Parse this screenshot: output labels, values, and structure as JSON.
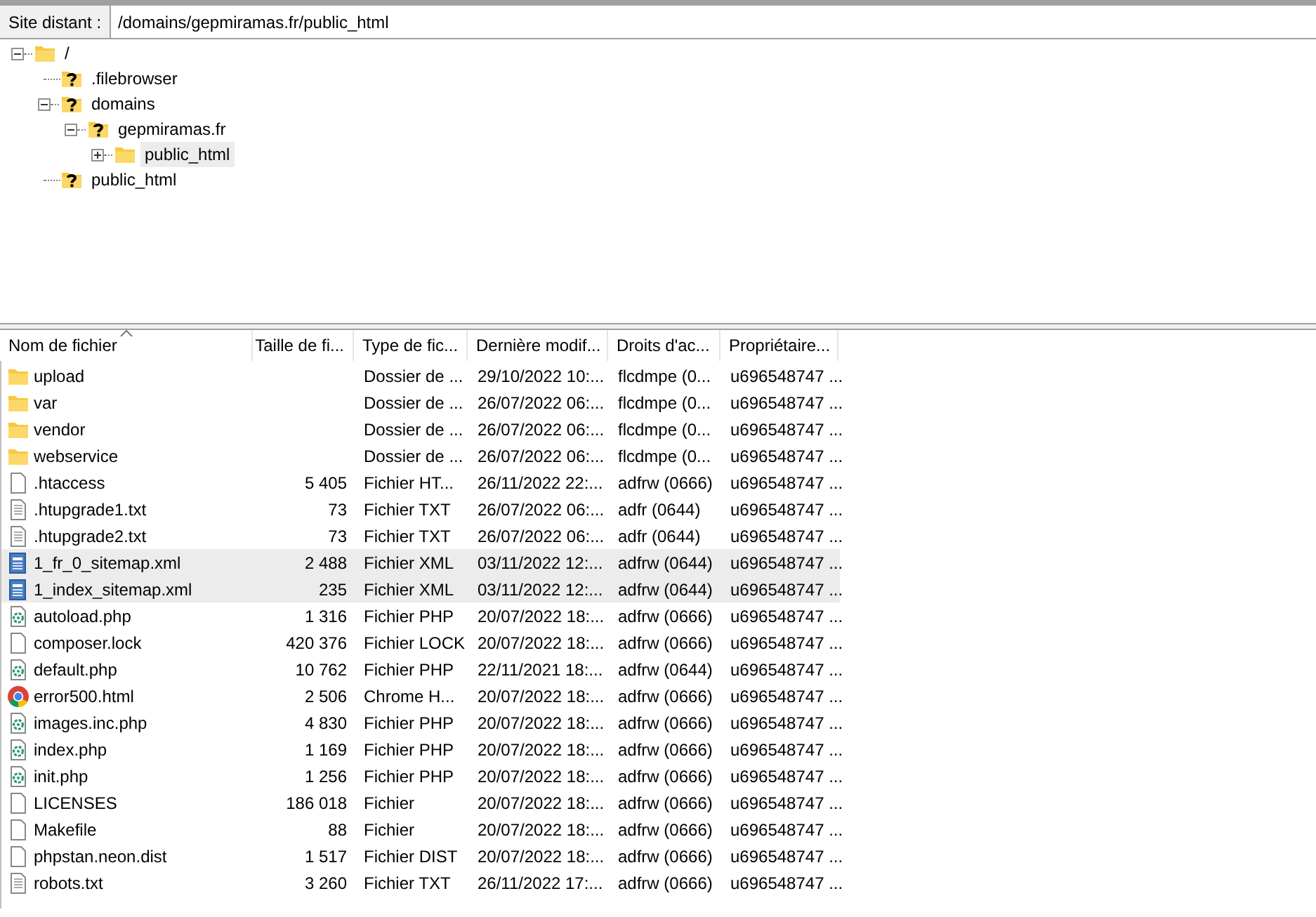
{
  "path_bar": {
    "label": "Site distant :",
    "value": "/domains/gepmiramas.fr/public_html"
  },
  "tree": [
    {
      "label": "/",
      "kind": "folder",
      "expandable": true,
      "expanded": true,
      "selected": false,
      "children": [
        {
          "label": ".filebrowser",
          "kind": "unknown",
          "expandable": false,
          "selected": false
        },
        {
          "label": "domains",
          "kind": "unknown",
          "expandable": true,
          "expanded": true,
          "selected": false,
          "children": [
            {
              "label": "gepmiramas.fr",
              "kind": "unknown",
              "expandable": true,
              "expanded": true,
              "selected": false,
              "children": [
                {
                  "label": "public_html",
                  "kind": "folder",
                  "expandable": true,
                  "expanded": false,
                  "selected": true
                }
              ]
            }
          ]
        },
        {
          "label": "public_html",
          "kind": "unknown",
          "expandable": false,
          "selected": false
        }
      ]
    }
  ],
  "file_list": {
    "columns": [
      {
        "label": "Nom de fichier",
        "sorted": true
      },
      {
        "label": "Taille de fi...",
        "sorted": false
      },
      {
        "label": "Type de fic...",
        "sorted": false
      },
      {
        "label": "Dernière modif...",
        "sorted": false
      },
      {
        "label": "Droits d'ac...",
        "sorted": false
      },
      {
        "label": "Propriétaire...",
        "sorted": false
      }
    ],
    "rows": [
      {
        "kind": "folder",
        "name": "upload",
        "type": "Dossier de ...",
        "modified": "29/10/2022 10:...",
        "rights": "flcdmpe (0...",
        "owner": "u696548747 ...",
        "selected": false
      },
      {
        "kind": "folder",
        "name": "var",
        "type": "Dossier de ...",
        "modified": "26/07/2022 06:...",
        "rights": "flcdmpe (0...",
        "owner": "u696548747 ...",
        "selected": false
      },
      {
        "kind": "folder",
        "name": "vendor",
        "type": "Dossier de ...",
        "modified": "26/07/2022 06:...",
        "rights": "flcdmpe (0...",
        "owner": "u696548747 ...",
        "selected": false
      },
      {
        "kind": "folder",
        "name": "webservice",
        "type": "Dossier de ...",
        "modified": "26/07/2022 06:...",
        "rights": "flcdmpe (0...",
        "owner": "u696548747 ...",
        "selected": false
      },
      {
        "kind": "file",
        "name": ".htaccess",
        "size": "5 405",
        "type": "Fichier HT...",
        "modified": "26/11/2022 22:...",
        "rights": "adfrw (0666)",
        "owner": "u696548747 ...",
        "selected": false
      },
      {
        "kind": "text",
        "name": ".htupgrade1.txt",
        "size": "73",
        "type": "Fichier TXT",
        "modified": "26/07/2022 06:...",
        "rights": "adfr (0644)",
        "owner": "u696548747 ...",
        "selected": false
      },
      {
        "kind": "text",
        "name": ".htupgrade2.txt",
        "size": "73",
        "type": "Fichier TXT",
        "modified": "26/07/2022 06:...",
        "rights": "adfr (0644)",
        "owner": "u696548747 ...",
        "selected": false
      },
      {
        "kind": "xml",
        "name": "1_fr_0_sitemap.xml",
        "size": "2 488",
        "type": "Fichier XML",
        "modified": "03/11/2022 12:...",
        "rights": "adfrw (0644)",
        "owner": "u696548747 ...",
        "selected": true
      },
      {
        "kind": "xml",
        "name": "1_index_sitemap.xml",
        "size": "235",
        "type": "Fichier XML",
        "modified": "03/11/2022 12:...",
        "rights": "adfrw (0644)",
        "owner": "u696548747 ...",
        "selected": true
      },
      {
        "kind": "php",
        "name": "autoload.php",
        "size": "1 316",
        "type": "Fichier PHP",
        "modified": "20/07/2022 18:...",
        "rights": "adfrw (0666)",
        "owner": "u696548747 ...",
        "selected": false
      },
      {
        "kind": "file",
        "name": "composer.lock",
        "size": "420 376",
        "type": "Fichier LOCK",
        "modified": "20/07/2022 18:...",
        "rights": "adfrw (0666)",
        "owner": "u696548747 ...",
        "selected": false
      },
      {
        "kind": "php",
        "name": "default.php",
        "size": "10 762",
        "type": "Fichier PHP",
        "modified": "22/11/2021 18:...",
        "rights": "adfrw (0644)",
        "owner": "u696548747 ...",
        "selected": false
      },
      {
        "kind": "browser",
        "name": "error500.html",
        "size": "2 506",
        "type": "Chrome H...",
        "modified": "20/07/2022 18:...",
        "rights": "adfrw (0666)",
        "owner": "u696548747 ...",
        "selected": false
      },
      {
        "kind": "php",
        "name": "images.inc.php",
        "size": "4 830",
        "type": "Fichier PHP",
        "modified": "20/07/2022 18:...",
        "rights": "adfrw (0666)",
        "owner": "u696548747 ...",
        "selected": false
      },
      {
        "kind": "php",
        "name": "index.php",
        "size": "1 169",
        "type": "Fichier PHP",
        "modified": "20/07/2022 18:...",
        "rights": "adfrw (0666)",
        "owner": "u696548747 ...",
        "selected": false
      },
      {
        "kind": "php",
        "name": "init.php",
        "size": "1 256",
        "type": "Fichier PHP",
        "modified": "20/07/2022 18:...",
        "rights": "adfrw (0666)",
        "owner": "u696548747 ...",
        "selected": false
      },
      {
        "kind": "file",
        "name": "LICENSES",
        "size": "186 018",
        "type": "Fichier",
        "modified": "20/07/2022 18:...",
        "rights": "adfrw (0666)",
        "owner": "u696548747 ...",
        "selected": false
      },
      {
        "kind": "file",
        "name": "Makefile",
        "size": "88",
        "type": "Fichier",
        "modified": "20/07/2022 18:...",
        "rights": "adfrw (0666)",
        "owner": "u696548747 ...",
        "selected": false
      },
      {
        "kind": "file",
        "name": "phpstan.neon.dist",
        "size": "1 517",
        "type": "Fichier DIST",
        "modified": "20/07/2022 18:...",
        "rights": "adfrw (0666)",
        "owner": "u696548747 ...",
        "selected": false
      },
      {
        "kind": "text",
        "name": "robots.txt",
        "size": "3 260",
        "type": "Fichier TXT",
        "modified": "26/11/2022 17:...",
        "rights": "adfrw (0666)",
        "owner": "u696548747 ...",
        "selected": false
      }
    ]
  }
}
